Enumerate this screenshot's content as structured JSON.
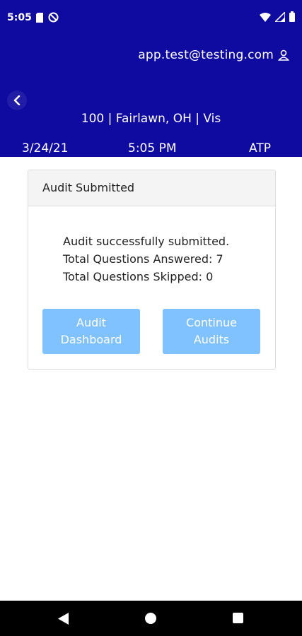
{
  "status_bar": {
    "time": "5:05"
  },
  "header": {
    "user_email": "app.test@testing.com",
    "location": "100 | Fairlawn, OH | Vis",
    "date": "3/24/21",
    "time": "5:05 PM",
    "code": "ATP"
  },
  "card": {
    "title": "Audit Submitted",
    "lines": [
      "Audit successfully submitted.",
      "Total Questions Answered: 7",
      "Total Questions Skipped: 0"
    ],
    "buttons": {
      "dashboard": "Audit\nDashboard",
      "continue": "Continue\nAudits"
    }
  },
  "colors": {
    "header_bg": "#0f0aa0",
    "button_bg": "#80c2ff",
    "nav_bg": "#000000"
  }
}
